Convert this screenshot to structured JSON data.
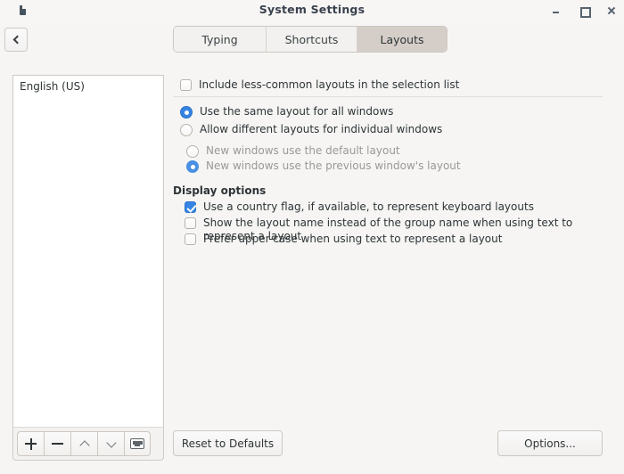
{
  "window": {
    "title": "System Settings",
    "app_icon": "app-icon",
    "controls": [
      {
        "name": "minimize",
        "icon": "minimize-icon"
      },
      {
        "name": "maximize",
        "icon": "maximize-icon"
      },
      {
        "name": "close",
        "icon": "close-icon"
      }
    ]
  },
  "header": {
    "back_icon": "chevron-left-icon",
    "tabs": [
      {
        "label": "Typing",
        "active": false
      },
      {
        "label": "Shortcuts",
        "active": false
      },
      {
        "label": "Layouts",
        "active": true
      }
    ]
  },
  "left_panel": {
    "layouts": [
      {
        "label": "English (US)"
      }
    ],
    "toolbar": [
      {
        "name": "add-layout-button",
        "icon": "plus-icon"
      },
      {
        "name": "remove-layout-button",
        "icon": "minus-icon"
      },
      {
        "name": "move-up-button",
        "icon": "chevron-up-icon"
      },
      {
        "name": "move-down-button",
        "icon": "chevron-down-icon"
      },
      {
        "name": "preview-layout-button",
        "icon": "keyboard-icon"
      }
    ]
  },
  "main": {
    "include_less_common": {
      "label": "Include less-common layouts in the selection list",
      "checked": false
    },
    "window_scope": {
      "options": [
        {
          "label": "Use the same layout for all windows",
          "selected": true,
          "disabled": false
        },
        {
          "label": "Allow different layouts for individual windows",
          "selected": false,
          "disabled": false
        }
      ],
      "sub_options": [
        {
          "label": "New windows use the default layout",
          "selected": false,
          "disabled": true
        },
        {
          "label": "New windows use the previous window's layout",
          "selected": true,
          "disabled": true
        }
      ]
    },
    "display_options": {
      "title": "Display options",
      "items": [
        {
          "label": "Use a country flag, if available,  to represent keyboard layouts",
          "checked": true
        },
        {
          "label": "Show the layout name instead of the group name when using text to represent a layout",
          "checked": false
        },
        {
          "label": "Prefer upper-case when using text to represent a layout",
          "checked": false
        }
      ]
    },
    "buttons": {
      "reset": "Reset to Defaults",
      "options": "Options..."
    }
  },
  "colors": {
    "accent": "#3584e4",
    "window_bg": "#f6f5f4",
    "tab_active_bg": "#d5cec8",
    "list_bg": "#ffffff",
    "disabled_text": "#9a9996"
  }
}
